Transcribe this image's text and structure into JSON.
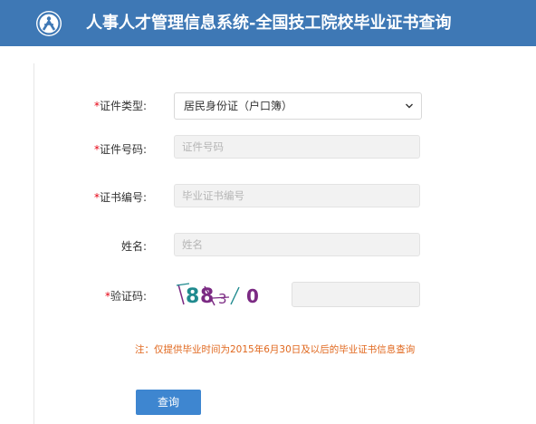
{
  "header": {
    "title": "人事人才管理信息系统-全国技工院校毕业证书查询"
  },
  "form": {
    "id_type": {
      "required_mark": "*",
      "label": "证件类型:",
      "selected": "居民身份证（户口簿）"
    },
    "id_number": {
      "required_mark": "*",
      "label": "证件号码:",
      "placeholder": "证件号码"
    },
    "cert_number": {
      "required_mark": "*",
      "label": "证书编号:",
      "placeholder": "毕业证书编号"
    },
    "name": {
      "label": "姓名:",
      "placeholder": "姓名"
    },
    "captcha": {
      "required_mark": "*",
      "label": "验证码:",
      "chars": [
        "8",
        "8",
        "3",
        "0"
      ],
      "input_value": ""
    }
  },
  "note": "注：仅提供毕业时间为2015年6月30日及以后的毕业证书信息查询",
  "buttons": {
    "query": "查询"
  },
  "colors": {
    "header_bg": "#3e78b5",
    "required": "#e60012",
    "note": "#e0671d",
    "button_bg": "#3e86d0",
    "captcha_teal": "#1f8a8e",
    "captcha_purple": "#7b2a83"
  },
  "icons": {
    "logo": "person-circle-logo",
    "select_arrow": "chevron-down-icon"
  }
}
